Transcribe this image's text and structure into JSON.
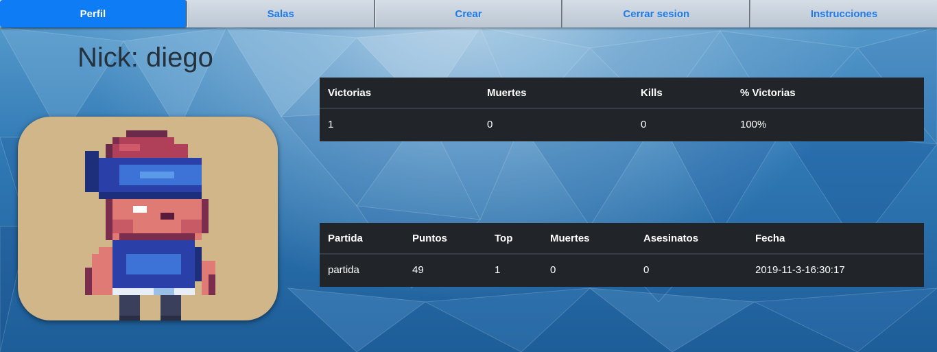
{
  "nav": {
    "items": [
      {
        "label": "Perfil",
        "active": true
      },
      {
        "label": "Salas"
      },
      {
        "label": "Crear"
      },
      {
        "label": "Cerrar sesion"
      },
      {
        "label": "Instrucciones"
      }
    ]
  },
  "profile": {
    "title": "Nick: diego",
    "avatar_icon": "pixel-character-avatar"
  },
  "stats_table": {
    "headers": [
      "Victorias",
      "Muertes",
      "Kills",
      "% Victorias"
    ],
    "rows": [
      [
        "1",
        "0",
        "0",
        "100%"
      ]
    ]
  },
  "games_table": {
    "headers": [
      "Partida",
      "Puntos",
      "Top",
      "Muertes",
      "Asesinatos",
      "Fecha"
    ],
    "rows": [
      [
        "partida",
        "49",
        "1",
        "0",
        "0",
        "2019-11-3-16:30:17"
      ]
    ]
  },
  "colors": {
    "nav_active": "#0d7cf5",
    "nav_link": "#1e7be8",
    "table_bg": "#212529",
    "avatar_bg": "#d1b68a"
  }
}
